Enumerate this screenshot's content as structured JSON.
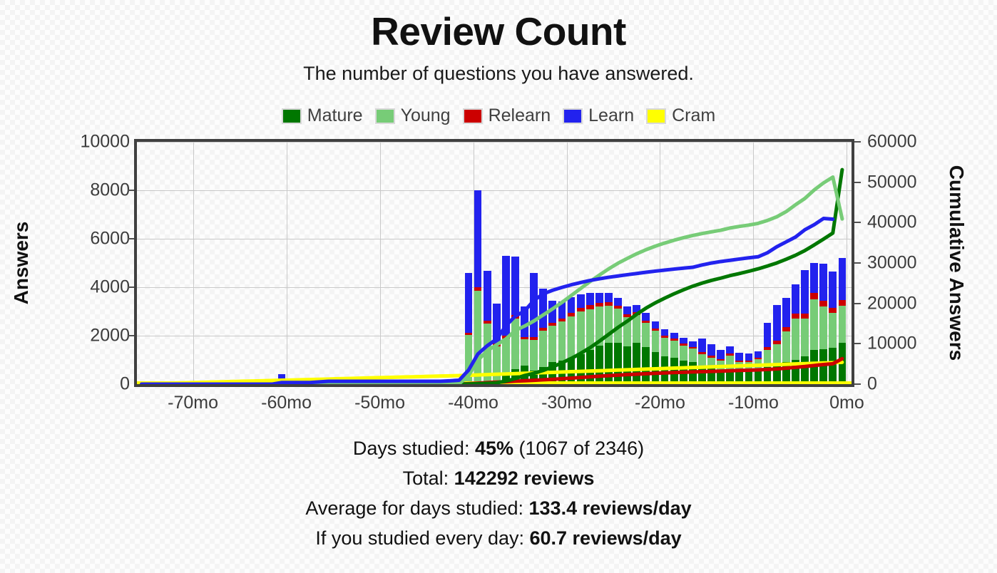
{
  "title": "Review Count",
  "subtitle": "The number of questions you have answered.",
  "legend": [
    {
      "label": "Mature",
      "color": "#007700"
    },
    {
      "label": "Young",
      "color": "#77cc77"
    },
    {
      "label": "Relearn",
      "color": "#cc0000"
    },
    {
      "label": "Learn",
      "color": "#2222ee"
    },
    {
      "label": "Cram",
      "color": "#ffff00"
    }
  ],
  "axes": {
    "ylabel_left": "Answers",
    "ylabel_right": "Cumulative Answers",
    "xlabel": ""
  },
  "footer": {
    "days_studied": {
      "prefix": "Days studied: ",
      "value": "45%",
      "suffix": " (1067 of 2346)"
    },
    "total": {
      "prefix": "Total: ",
      "value": "142292 reviews",
      "suffix": ""
    },
    "average_studied": {
      "prefix": "Average for days studied: ",
      "value": "133.4 reviews/day",
      "suffix": ""
    },
    "average_everyday": {
      "prefix": "If you studied every day: ",
      "value": "60.7 reviews/day",
      "suffix": ""
    }
  },
  "chart_data": {
    "type": "bar",
    "title": "Review Count",
    "subtitle": "The number of questions you have answered.",
    "xlabel": "",
    "ylabel": "Answers",
    "y2label": "Cumulative Answers",
    "ylim": [
      0,
      10000
    ],
    "y2lim": [
      0,
      60000
    ],
    "yticks": [
      0,
      2000,
      4000,
      6000,
      8000,
      10000
    ],
    "y2ticks": [
      0,
      10000,
      20000,
      30000,
      40000,
      50000,
      60000
    ],
    "xticks": [
      "-70mo",
      "-60mo",
      "-50mo",
      "-40mo",
      "-30mo",
      "-20mo",
      "-10mo",
      "0mo"
    ],
    "xtick_values": [
      -70,
      -60,
      -50,
      -40,
      -30,
      -20,
      -10,
      0
    ],
    "xlim": [
      -76,
      0.5
    ],
    "grid": true,
    "legend_position": "top",
    "stacking_order": [
      "Mature",
      "Young",
      "Relearn",
      "Learn",
      "Cram"
    ],
    "bar_x": [
      -75.5,
      -74.5,
      -73.5,
      -72.5,
      -71.5,
      -70.5,
      -69.5,
      -68.5,
      -67.5,
      -66.5,
      -65.5,
      -64.5,
      -63.5,
      -62.5,
      -61.5,
      -60.5,
      -59.5,
      -58.5,
      -57.5,
      -56.5,
      -55.5,
      -54.5,
      -53.5,
      -52.5,
      -51.5,
      -50.5,
      -49.5,
      -48.5,
      -47.5,
      -46.5,
      -45.5,
      -44.5,
      -43.5,
      -42.5,
      -41.5,
      -40.5,
      -39.5,
      -38.5,
      -37.5,
      -36.5,
      -35.5,
      -34.5,
      -33.5,
      -32.5,
      -31.5,
      -30.5,
      -29.5,
      -28.5,
      -27.5,
      -26.5,
      -25.5,
      -24.5,
      -23.5,
      -22.5,
      -21.5,
      -20.5,
      -19.5,
      -18.5,
      -17.5,
      -16.5,
      -15.5,
      -14.5,
      -13.5,
      -12.5,
      -11.5,
      -10.5,
      -9.5,
      -8.5,
      -7.5,
      -6.5,
      -5.5,
      -4.5,
      -3.5,
      -2.5,
      -1.5,
      -0.5
    ],
    "series": [
      {
        "name": "Mature",
        "color": "#007700",
        "values": [
          0,
          0,
          0,
          0,
          0,
          0,
          0,
          0,
          0,
          0,
          0,
          0,
          0,
          0,
          0,
          0,
          0,
          0,
          0,
          0,
          0,
          0,
          0,
          0,
          0,
          0,
          0,
          0,
          0,
          0,
          0,
          0,
          0,
          0,
          0,
          40,
          60,
          100,
          120,
          430,
          620,
          760,
          560,
          700,
          900,
          980,
          1100,
          1250,
          1400,
          1600,
          1700,
          1720,
          1560,
          1700,
          1520,
          1320,
          1150,
          1080,
          980,
          900,
          760,
          680,
          560,
          620,
          520,
          560,
          600,
          700,
          760,
          900,
          1000,
          1150,
          1400,
          1450,
          1500,
          1700
        ]
      },
      {
        "name": "Young",
        "color": "#77cc77",
        "values": [
          0,
          0,
          0,
          0,
          0,
          0,
          0,
          0,
          0,
          0,
          0,
          0,
          0,
          0,
          0,
          0,
          0,
          0,
          0,
          0,
          0,
          0,
          0,
          0,
          0,
          0,
          0,
          0,
          0,
          0,
          0,
          0,
          0,
          40,
          60,
          1980,
          3800,
          2400,
          1450,
          1450,
          2100,
          1100,
          1260,
          1500,
          1500,
          1600,
          1700,
          1750,
          1700,
          1600,
          1550,
          1400,
          1200,
          1150,
          1000,
          880,
          760,
          700,
          620,
          560,
          480,
          420,
          400,
          560,
          380,
          340,
          420,
          720,
          900,
          1280,
          1700,
          1560,
          2100,
          1750,
          1450,
          1550
        ]
      },
      {
        "name": "Relearn",
        "color": "#cc0000",
        "values": [
          0,
          0,
          0,
          0,
          0,
          0,
          0,
          0,
          0,
          0,
          0,
          0,
          0,
          0,
          0,
          0,
          0,
          0,
          0,
          0,
          0,
          0,
          0,
          0,
          0,
          0,
          0,
          0,
          0,
          0,
          0,
          0,
          0,
          0,
          0,
          100,
          140,
          130,
          110,
          120,
          140,
          90,
          110,
          130,
          130,
          140,
          150,
          160,
          160,
          150,
          140,
          130,
          120,
          120,
          110,
          100,
          90,
          90,
          80,
          80,
          70,
          70,
          70,
          90,
          70,
          60,
          70,
          110,
          130,
          180,
          220,
          200,
          260,
          230,
          200,
          210
        ]
      },
      {
        "name": "Learn",
        "color": "#2222ee",
        "values": [
          0,
          0,
          0,
          0,
          0,
          0,
          0,
          0,
          0,
          0,
          0,
          0,
          0,
          0,
          0,
          400,
          0,
          0,
          0,
          160,
          140,
          0,
          0,
          0,
          0,
          0,
          0,
          0,
          0,
          0,
          0,
          0,
          0,
          120,
          160,
          2480,
          4000,
          2040,
          1650,
          3290,
          2400,
          1250,
          2660,
          1600,
          900,
          700,
          650,
          560,
          500,
          420,
          380,
          320,
          320,
          300,
          300,
          280,
          260,
          250,
          230,
          220,
          560,
          480,
          380,
          300,
          320,
          300,
          260,
          1000,
          1480,
          1200,
          1200,
          1800,
          1250,
          1550,
          1500,
          1750
        ]
      },
      {
        "name": "Cram",
        "color": "#ffff00",
        "values": [
          60,
          60,
          60,
          60,
          60,
          60,
          60,
          60,
          60,
          60,
          60,
          60,
          60,
          60,
          60,
          60,
          60,
          60,
          60,
          60,
          60,
          80,
          60,
          60,
          60,
          60,
          60,
          60,
          60,
          60,
          60,
          60,
          60,
          60,
          60,
          80,
          80,
          80,
          80,
          80,
          80,
          80,
          80,
          80,
          80,
          80,
          80,
          80,
          80,
          80,
          80,
          80,
          80,
          80,
          80,
          80,
          80,
          80,
          80,
          80,
          80,
          80,
          80,
          80,
          80,
          80,
          80,
          80,
          80,
          80,
          80,
          80,
          80,
          80,
          80,
          90
        ]
      }
    ],
    "cumulative_lines": [
      {
        "name": "Mature cumulative",
        "color": "#007700",
        "axis": "right",
        "values": [
          0,
          0,
          0,
          0,
          0,
          0,
          0,
          0,
          0,
          0,
          0,
          0,
          0,
          0,
          0,
          0,
          0,
          0,
          0,
          0,
          0,
          0,
          0,
          0,
          0,
          0,
          0,
          0,
          0,
          0,
          0,
          0,
          0,
          0,
          0,
          40,
          100,
          200,
          320,
          750,
          1370,
          2130,
          2690,
          3390,
          4290,
          5270,
          6370,
          7620,
          9020,
          10620,
          12320,
          14040,
          15600,
          17300,
          18820,
          20140,
          21290,
          22370,
          23350,
          24250,
          25010,
          25690,
          26250,
          26870,
          27390,
          27950,
          28550,
          29250,
          30010,
          30910,
          31910,
          33060,
          34460,
          35910,
          37410,
          53100
        ]
      },
      {
        "name": "Young cumulative",
        "color": "#77cc77",
        "axis": "right",
        "values": [
          0,
          0,
          0,
          0,
          0,
          0,
          0,
          0,
          0,
          0,
          0,
          0,
          0,
          0,
          0,
          0,
          0,
          0,
          0,
          0,
          0,
          0,
          0,
          0,
          0,
          0,
          0,
          0,
          0,
          0,
          0,
          0,
          0,
          40,
          100,
          2080,
          5880,
          8280,
          9730,
          11180,
          13280,
          14380,
          15640,
          17140,
          18640,
          20240,
          21940,
          23690,
          25390,
          26990,
          28540,
          29940,
          31140,
          32290,
          33290,
          34170,
          34930,
          35630,
          36250,
          36810,
          37290,
          37710,
          38110,
          38670,
          39050,
          39390,
          39810,
          40530,
          41430,
          42710,
          44410,
          45970,
          48070,
          49820,
          51270,
          40900
        ]
      },
      {
        "name": "Relearn cumulative",
        "color": "#cc0000",
        "axis": "right",
        "values": [
          0,
          0,
          0,
          0,
          0,
          0,
          0,
          0,
          0,
          0,
          0,
          0,
          0,
          0,
          0,
          0,
          0,
          0,
          0,
          0,
          0,
          0,
          0,
          0,
          0,
          0,
          0,
          0,
          0,
          0,
          0,
          0,
          0,
          0,
          0,
          100,
          240,
          370,
          480,
          600,
          740,
          830,
          940,
          1070,
          1200,
          1340,
          1490,
          1650,
          1810,
          1960,
          2100,
          2230,
          2350,
          2470,
          2580,
          2680,
          2770,
          2860,
          2940,
          3020,
          3090,
          3160,
          3230,
          3320,
          3390,
          3450,
          3520,
          3630,
          3760,
          3940,
          4160,
          4360,
          4620,
          4850,
          5050,
          6300
        ]
      },
      {
        "name": "Learn cumulative",
        "color": "#2222ee",
        "axis": "right",
        "values": [
          0,
          0,
          0,
          0,
          0,
          0,
          0,
          0,
          0,
          0,
          0,
          0,
          0,
          0,
          0,
          400,
          400,
          400,
          400,
          560,
          700,
          700,
          700,
          700,
          700,
          700,
          700,
          700,
          700,
          700,
          700,
          700,
          700,
          820,
          980,
          3460,
          7460,
          9500,
          11150,
          14440,
          16840,
          18090,
          20750,
          22350,
          23250,
          23950,
          24600,
          25160,
          25660,
          26080,
          26460,
          26780,
          27100,
          27400,
          27700,
          27980,
          28240,
          28490,
          28720,
          28940,
          29500,
          29980,
          30360,
          30660,
          30980,
          31280,
          31540,
          32540,
          34020,
          35220,
          36420,
          38220,
          39470,
          41020,
          40850
        ]
      },
      {
        "name": "Cram cumulative",
        "color": "#ffff00",
        "axis": "right",
        "values": [
          60,
          120,
          180,
          240,
          300,
          360,
          420,
          480,
          540,
          600,
          660,
          720,
          780,
          840,
          900,
          960,
          1020,
          1080,
          1140,
          1200,
          1260,
          1340,
          1400,
          1460,
          1520,
          1580,
          1640,
          1700,
          1760,
          1820,
          1880,
          1940,
          2000,
          2060,
          2120,
          2200,
          2280,
          2360,
          2440,
          2520,
          2600,
          2680,
          2760,
          2840,
          2920,
          3000,
          3080,
          3160,
          3240,
          3320,
          3400,
          3480,
          3560,
          3640,
          3720,
          3800,
          3880,
          3960,
          4040,
          4120,
          4200,
          4280,
          4360,
          4440,
          4520,
          4600,
          4680,
          4760,
          4840,
          4920,
          5000,
          5080,
          5160,
          5240,
          5320,
          5410
        ]
      }
    ]
  }
}
